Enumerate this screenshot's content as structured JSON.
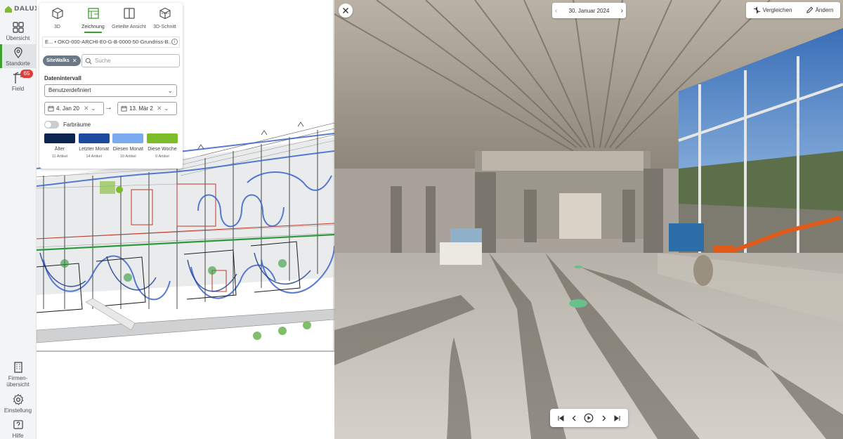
{
  "app": {
    "logo_text": "DALUX"
  },
  "nav": {
    "uebersicht": "Übersicht",
    "standorte": "Standorte",
    "field": "Field",
    "field_badge": "65",
    "firmen": "Firmen-\nübersicht",
    "einstellung": "Einstellung",
    "hilfe": "Hilfe"
  },
  "panel": {
    "tabs": [
      "3D",
      "Zeichnung",
      "Geteilte Ansicht",
      "3D-Schnitt"
    ],
    "active_tab": "Zeichnung",
    "document": "E... • OKO-000-ARCHI-E0-G-B-0000-50-Grundriss-B...",
    "filter_chip": "SiteWalks",
    "search_placeholder": "Suche",
    "date_interval_label": "Datenintervall",
    "date_interval_value": "Benutzerdefiniert",
    "date_from": "4. Jan 20",
    "date_to": "13. Mär 2",
    "toggle_label": "Farbräume",
    "legend": [
      {
        "name": "Älter",
        "count": "11 Artikel",
        "color": "#0b2550"
      },
      {
        "name": "Letzter Monat",
        "count": "14 Artikel",
        "color": "#1b4aa0"
      },
      {
        "name": "Diesen Monat",
        "count": "10 Artikel",
        "color": "#7aaaf0"
      },
      {
        "name": "Diese Woche",
        "count": "0 Artikel",
        "color": "#7cbd29"
      }
    ]
  },
  "viewer": {
    "date": "30. Januar 2024",
    "compare_label": "Vergleichen",
    "change_label": "Ändern"
  }
}
